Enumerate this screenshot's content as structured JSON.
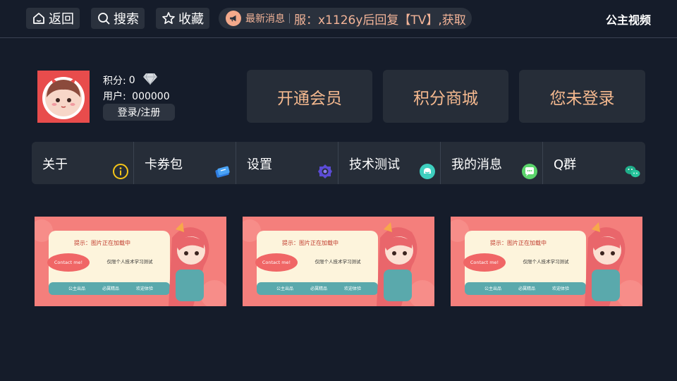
{
  "toolbar": {
    "back_label": "返回",
    "search_label": "搜索",
    "favorite_label": "收藏"
  },
  "news": {
    "label": "最新消息",
    "text": "服：x1126y后回复【TV】,获取"
  },
  "app_title": "公主视频",
  "profile": {
    "points_label": "积分:",
    "points_value": "0",
    "user_label": "用户:",
    "user_value": "000000",
    "login_label": "登录/注册"
  },
  "actions": {
    "vip_label": "开通会员",
    "shop_label": "积分商城",
    "status_label": "您未登录"
  },
  "menu": {
    "items": [
      {
        "label": "关于",
        "icon": "info-icon"
      },
      {
        "label": "卡券包",
        "icon": "ticket-icon"
      },
      {
        "label": "设置",
        "icon": "gear-icon"
      },
      {
        "label": "技术测试",
        "icon": "test-icon"
      },
      {
        "label": "我的消息",
        "icon": "message-icon"
      },
      {
        "label": "Q群",
        "icon": "wechat-icon"
      }
    ]
  },
  "banner": {
    "title": "提示：图片正在加载中",
    "subtitle": "仅限个人技术学习测试",
    "footer": [
      "公主出品",
      "必属精品",
      "欢迎体验"
    ],
    "bubble": "Contact me!"
  },
  "colors": {
    "background": "#151c2a",
    "panel": "#262d38",
    "accent": "#f5b98f",
    "banner_bg": "#f47f7c"
  }
}
